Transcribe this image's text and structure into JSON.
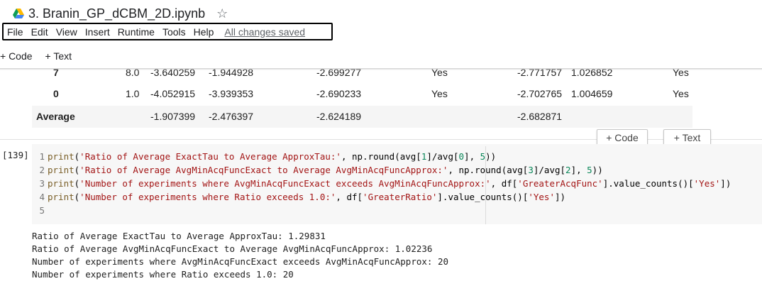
{
  "header": {
    "notebook_title": "3. Branin_GP_dCBM_2D.ipynb",
    "star": "☆",
    "menu": [
      "File",
      "Edit",
      "View",
      "Insert",
      "Runtime",
      "Tools",
      "Help"
    ],
    "saved_status": "All changes saved"
  },
  "toolbar": {
    "add_code": "+ Code",
    "add_text": "+ Text"
  },
  "cell_toolbar": {
    "add_code": "+ Code",
    "add_text": "+ Text"
  },
  "dataframe": {
    "rows": [
      {
        "index": "7",
        "c1": "8.0",
        "c2": "-3.640259",
        "c3": "-1.944928",
        "c4": "-2.699277",
        "c5": "Yes",
        "c6": "-2.771757",
        "c7": "1.026852",
        "c8": "Yes"
      },
      {
        "index": "0",
        "c1": "1.0",
        "c2": "-4.052915",
        "c3": "-3.939353",
        "c4": "-2.690233",
        "c5": "Yes",
        "c6": "-2.702765",
        "c7": "1.004659",
        "c8": "Yes"
      },
      {
        "index": "Average",
        "c1": "",
        "c2": "-1.907399",
        "c3": "-2.476397",
        "c4": "-2.624189",
        "c5": "",
        "c6": "-2.682871",
        "c7": "",
        "c8": ""
      }
    ]
  },
  "code_cell": {
    "execution_count": "[139]",
    "line_numbers": [
      "1",
      "2",
      "3",
      "4",
      "5"
    ],
    "lines": [
      {
        "fn": "print",
        "p1": "(",
        "s1": "'Ratio of Average ExactTau to Average ApproxTau:'",
        "p2": ", np.round(avg[",
        "n1": "1",
        "p3": "]/avg[",
        "n2": "0",
        "p4": "], ",
        "n3": "5",
        "p5": "))"
      },
      {
        "fn": "print",
        "p1": "(",
        "s1": "'Ratio of Average AvgMinAcqFuncExact to Average AvgMinAcqFuncApprox:'",
        "p2": ", np.round(avg[",
        "n1": "3",
        "p3": "]/avg[",
        "n2": "2",
        "p4": "], ",
        "n3": "5",
        "p5": "))"
      },
      {
        "fn": "print",
        "p1": "(",
        "s1": "'Number of experiments where AvgMinAcqFuncExact exceeds AvgMinAcqFuncApprox:'",
        "p2": ", df[",
        "s2": "'GreaterAcqFunc'",
        "p3": "].value_counts()[",
        "s3": "'Yes'",
        "p4": "])"
      },
      {
        "fn": "print",
        "p1": "(",
        "s1": "'Number of experiments where Ratio exceeds 1.0:'",
        "p2": ", df[",
        "s2": "'GreaterRatio'",
        "p3": "].value_counts()[",
        "s3": "'Yes'",
        "p4": "])"
      }
    ]
  },
  "output": [
    "Ratio of Average ExactTau to Average ApproxTau: 1.29831",
    "Ratio of Average AvgMinAcqFuncExact to Average AvgMinAcqFuncApprox: 1.02236",
    "Number of experiments where AvgMinAcqFuncExact exceeds AvgMinAcqFuncApprox: 20",
    "Number of experiments where Ratio exceeds 1.0: 20"
  ],
  "colors": {
    "string": "#a31515",
    "number": "#098658",
    "function": "#795e26"
  }
}
